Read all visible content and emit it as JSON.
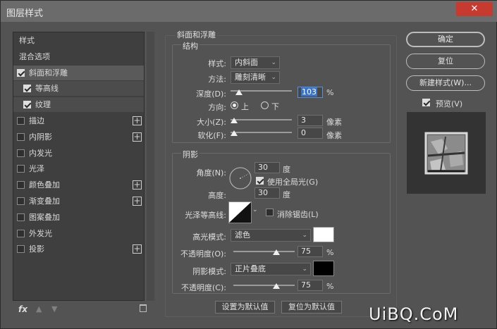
{
  "window": {
    "title": "图层样式",
    "close": "✕"
  },
  "left_panel": {
    "items": [
      {
        "label": "样式",
        "checkbox": false
      },
      {
        "label": "混合选项",
        "checkbox": false
      },
      {
        "label": "斜面和浮雕",
        "checkbox": true,
        "checked": true,
        "selected": true
      },
      {
        "label": "等高线",
        "checkbox": true,
        "checked": true,
        "sub": true
      },
      {
        "label": "纹理",
        "checkbox": true,
        "checked": true,
        "sub": true
      },
      {
        "label": "描边",
        "checkbox": true,
        "checked": false,
        "plus": true
      },
      {
        "label": "内阴影",
        "checkbox": true,
        "checked": false,
        "plus": true
      },
      {
        "label": "内发光",
        "checkbox": true,
        "checked": false
      },
      {
        "label": "光泽",
        "checkbox": true,
        "checked": false
      },
      {
        "label": "颜色叠加",
        "checkbox": true,
        "checked": false,
        "plus": true
      },
      {
        "label": "渐变叠加",
        "checkbox": true,
        "checked": false,
        "plus": true
      },
      {
        "label": "图案叠加",
        "checkbox": true,
        "checked": false
      },
      {
        "label": "外发光",
        "checkbox": true,
        "checked": false
      },
      {
        "label": "投影",
        "checkbox": true,
        "checked": false,
        "plus": true
      }
    ],
    "plus_glyph": "+",
    "fx": "fx",
    "up_arrow": "▲",
    "down_arrow": "▼"
  },
  "bevel": {
    "group_title": "斜面和浮雕",
    "structure_title": "结构",
    "style_label": "样式:",
    "style_value": "内斜面",
    "method_label": "方法:",
    "method_value": "雕刻清晰",
    "depth_label": "深度(D):",
    "depth_value": "103",
    "depth_pct": 0.103,
    "depth_unit": "%",
    "direction_label": "方向:",
    "dir_up": "上",
    "dir_down": "下",
    "size_label": "大小(Z):",
    "size_value": "3",
    "size_unit": "像素",
    "soften_label": "软化(F):",
    "soften_value": "0",
    "soften_unit": "像素"
  },
  "shading": {
    "title": "阴影",
    "angle_label": "角度(N):",
    "angle_value": "30",
    "angle_unit": "度",
    "global_light_label": "使用全局光(G)",
    "altitude_label": "高度:",
    "altitude_value": "30",
    "altitude_unit": "度",
    "gloss_label": "光泽等高线:",
    "antialias_label": "消除锯齿(L)",
    "highlight_mode_label": "高光模式:",
    "highlight_mode_value": "滤色",
    "highlight_color": "#ffffff",
    "highlight_opacity_label": "不透明度(O):",
    "highlight_opacity_value": "75",
    "highlight_opacity_unit": "%",
    "shadow_mode_label": "阴影模式:",
    "shadow_mode_value": "正片叠底",
    "shadow_color": "#000000",
    "shadow_opacity_label": "不透明度(C):",
    "shadow_opacity_value": "75",
    "shadow_opacity_unit": "%"
  },
  "footer": {
    "make_default": "设置为默认值",
    "reset_default": "复位为默认值"
  },
  "right": {
    "ok": "确定",
    "reset": "复位",
    "new_style": "新建样式(W)...",
    "preview_label": "预览(V)"
  },
  "watermark": "UiBQ.CoM"
}
